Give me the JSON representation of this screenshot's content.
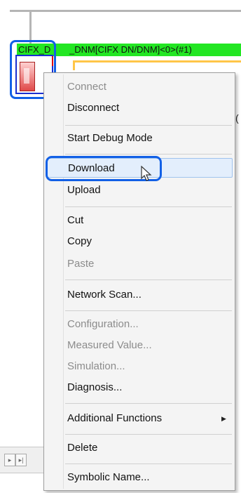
{
  "device": {
    "label_left": "CIFX_D",
    "label_right": "_DNM[CIFX DN/DNM]<0>(#1)",
    "paren_text": "("
  },
  "menu": {
    "items": [
      {
        "label": "Connect",
        "underline": "C",
        "enabled": false
      },
      {
        "label": "Disconnect",
        "underline": "D",
        "enabled": true
      },
      {
        "label": "Start Debug Mode",
        "underline": "D",
        "enabled": true
      },
      {
        "label": "Download",
        "underline": "o",
        "enabled": true,
        "hovered": true
      },
      {
        "label": "Upload",
        "underline": "U",
        "enabled": true
      },
      {
        "label": "Cut",
        "underline": "t",
        "enabled": true
      },
      {
        "label": "Copy",
        "underline": "C",
        "enabled": true
      },
      {
        "label": "Paste",
        "underline": "P",
        "enabled": false
      },
      {
        "label": "Network Scan...",
        "underline": "N",
        "enabled": true
      },
      {
        "label": "Configuration...",
        "enabled": false
      },
      {
        "label": "Measured Value...",
        "enabled": false
      },
      {
        "label": "Simulation...",
        "enabled": false
      },
      {
        "label": "Diagnosis...",
        "enabled": true
      },
      {
        "label": "Additional Functions",
        "enabled": true,
        "submenu": true
      },
      {
        "label": "Delete",
        "underline": "D",
        "enabled": true
      },
      {
        "label": "Symbolic Name...",
        "enabled": true
      }
    ]
  },
  "colors": {
    "highlight_outline": "#1260e6",
    "device_label_bg": "#23e623",
    "bus_line": "#b5b5b5",
    "orange_line": "#ffc648"
  },
  "icons": {
    "submenu_arrow": "▶",
    "nav_first": "⏮",
    "nav_last": "▶|"
  }
}
